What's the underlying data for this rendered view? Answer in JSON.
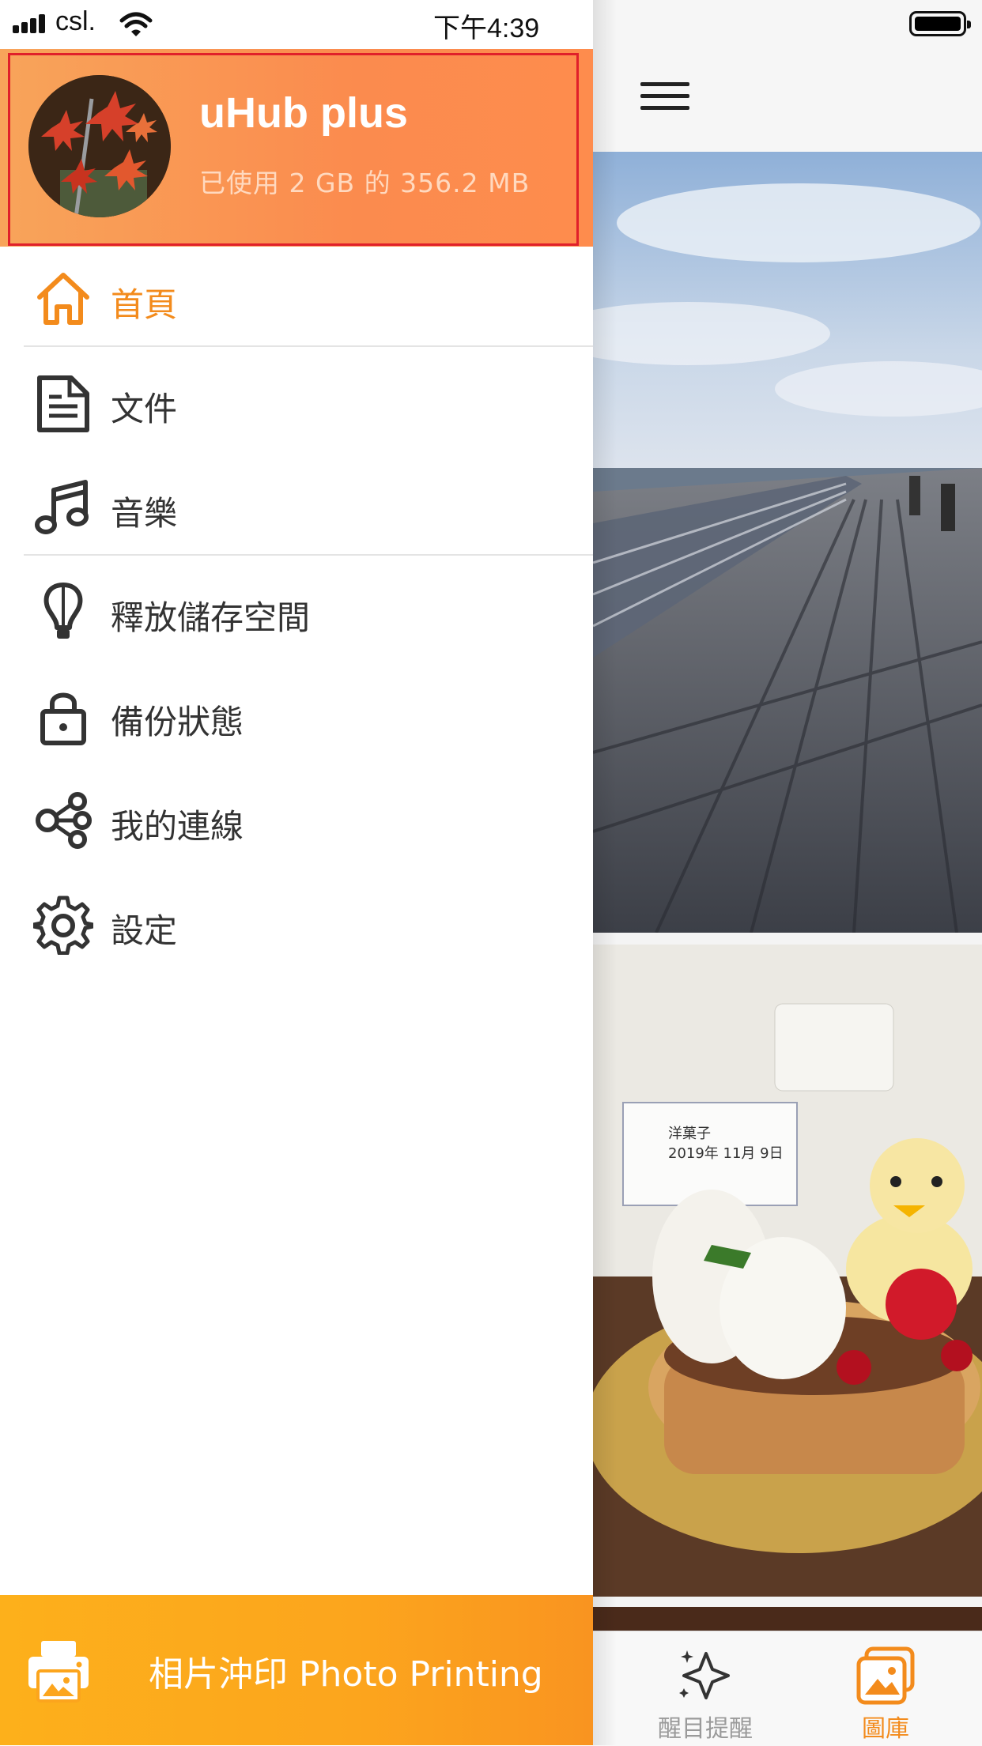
{
  "status_bar": {
    "carrier": "csl.",
    "time": "下午4:39"
  },
  "drawer": {
    "device_name": "uHub plus",
    "storage_usage": "已使用 2 GB 的 356.2 MB",
    "menu": [
      {
        "label": "首頁",
        "icon": "home-icon",
        "active": true
      },
      {
        "label": "文件",
        "icon": "document-icon"
      },
      {
        "label": "音樂",
        "icon": "music-note-icon"
      },
      {
        "label": "釋放儲存空間",
        "icon": "lightbulb-icon"
      },
      {
        "label": "備份狀態",
        "icon": "lock-icon"
      },
      {
        "label": "我的連線",
        "icon": "connection-nodes-icon"
      },
      {
        "label": "設定",
        "icon": "gear-icon"
      }
    ],
    "print_button": "相片沖印 Photo Printing"
  },
  "photo_card": {
    "label_name": "洋菓子",
    "label_date": "2019年 11月 9日"
  },
  "bottom_tabs": [
    {
      "label": "醒目提醒",
      "icon": "sparkle-icon"
    },
    {
      "label": "圖庫",
      "icon": "gallery-icon",
      "active": true
    }
  ],
  "colors": {
    "accent": "#f38b1c",
    "header_gradient_start": "#f8a45a",
    "header_gradient_end": "#fe8c4d",
    "print_bar": "#fdb01b",
    "highlight_border": "#e0202a"
  }
}
